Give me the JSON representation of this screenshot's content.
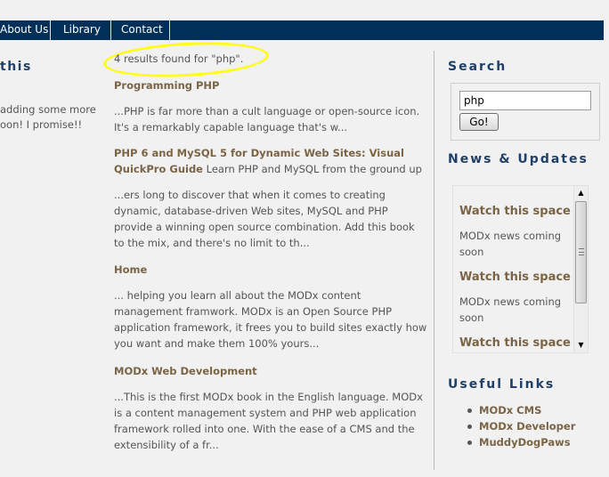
{
  "nav": {
    "items": [
      {
        "label": "About Us"
      },
      {
        "label": "Library"
      },
      {
        "label": "Contact"
      }
    ]
  },
  "left": {
    "heading": "this",
    "line1": "adding some more",
    "line2": "oon! I promise!!"
  },
  "search_results": {
    "count_text": "4 results found for \"php\".",
    "results": [
      {
        "title": "Programming PHP",
        "inline": "",
        "excerpt": "...PHP is far more than a cult language or open-source icon. It's a remarkably capable language that's w..."
      },
      {
        "title": "PHP 6 and MySQL 5 for Dynamic Web Sites: Visual QuickPro Guide",
        "inline": " Learn PHP and MySQL from the ground up",
        "excerpt": "...ers long to discover that when it comes to creating dynamic, database-driven Web sites, MySQL and PHP provide a winning open source combination. Add this book to the mix, and there's no limit to th..."
      },
      {
        "title": "Home",
        "inline": "",
        "excerpt": "... helping you learn all about the MODx content management framwork.  MODx is an Open Source PHP application framework, it frees you to build sites exactly how you want and make them 100% yours..."
      },
      {
        "title": "MODx Web Development",
        "inline": "",
        "excerpt": "...This is the first MODx book in the English language.  MODx is a content management system and PHP web application framework rolled into one. With the ease of a CMS and the extensibility of a fr..."
      }
    ]
  },
  "sidebar": {
    "search_heading": "Search",
    "search_value": "php",
    "go_label": "Go!",
    "news_heading": "News & Updates",
    "news_items": [
      {
        "title": "Watch this space",
        "text": "MODx news coming soon"
      },
      {
        "title": "Watch this space",
        "text": "MODx news coming soon"
      },
      {
        "title": "Watch this space",
        "text": ""
      }
    ],
    "links_heading": "Useful Links",
    "links": [
      {
        "label": "MODx CMS"
      },
      {
        "label": "MODx Developer"
      },
      {
        "label": "MuddyDogPaws"
      }
    ]
  },
  "colors": {
    "nav_bg": "#00305a",
    "heading": "#1f3f67",
    "link": "#7a6445",
    "highlight": "#ffff14"
  }
}
